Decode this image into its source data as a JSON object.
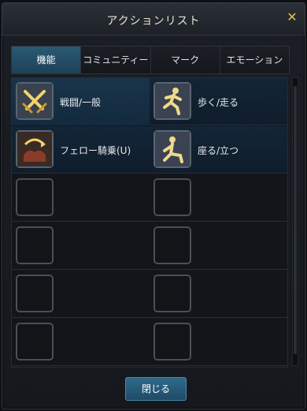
{
  "window": {
    "title": "アクションリスト",
    "close_icon": "close-icon"
  },
  "tabs": [
    {
      "label": "機能",
      "active": true
    },
    {
      "label": "コミュニティー",
      "active": false
    },
    {
      "label": "マーク",
      "active": false
    },
    {
      "label": "エモーション",
      "active": false
    }
  ],
  "actions": [
    {
      "label": "戦闘/一般",
      "icon": "crossed-swords-icon"
    },
    {
      "label": "歩く/走る",
      "icon": "running-figure-icon"
    },
    {
      "label": "フェロー騎乗(U)",
      "icon": "mount-saddle-icon"
    },
    {
      "label": "座る/立つ",
      "icon": "sitting-figure-icon"
    }
  ],
  "footer": {
    "close_button": "閉じる"
  }
}
